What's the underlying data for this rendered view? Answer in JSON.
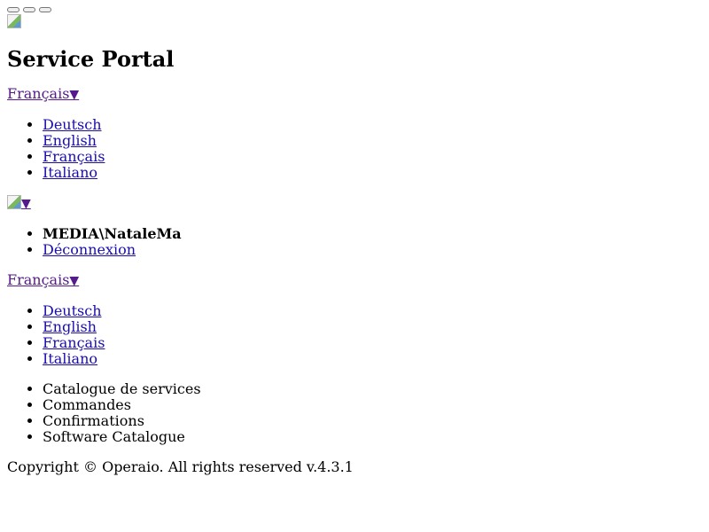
{
  "window_buttons": [
    "minimize",
    "maximize",
    "close"
  ],
  "logo": {
    "icon": "broken-image-icon"
  },
  "title": "Service Portal",
  "language_switcher_top": {
    "current": "Français",
    "caret": "▼",
    "options": [
      "Deutsch",
      "English",
      "Français",
      "Italiano"
    ]
  },
  "user_menu": {
    "avatar_icon": "broken-image-icon",
    "caret": "▼",
    "username": "MEDIA\\NataleMa",
    "logout": "Déconnexion"
  },
  "language_switcher_bottom": {
    "current": "Français",
    "caret": "▼",
    "options": [
      "Deutsch",
      "English",
      "Français",
      "Italiano"
    ]
  },
  "nav": {
    "items": [
      "Catalogue de services",
      "Commandes",
      "Confirmations",
      "Software Catalogue"
    ]
  },
  "footer": {
    "copyright": "Copyright © Operaio. All rights reserved v.4.3.1"
  }
}
